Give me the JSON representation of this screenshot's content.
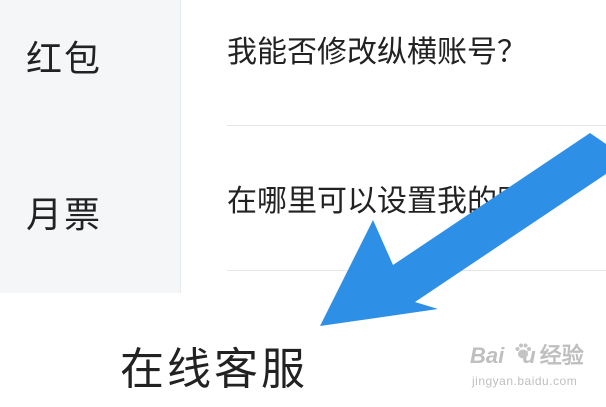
{
  "sidebar": {
    "items": [
      {
        "label": "红包"
      },
      {
        "label": "月票"
      }
    ]
  },
  "questions": {
    "items": [
      {
        "text": "我能否修改纵横账号？"
      },
      {
        "text": "在哪里可以设置我的账户"
      }
    ]
  },
  "bottom_bar": {
    "service_label": "在线客服"
  },
  "annotation": {
    "arrow_color": "#2e8fe6"
  },
  "watermark": {
    "brand_left": "Bai",
    "brand_right": "u",
    "brand_cn": "经验",
    "url": "jingyan.baidu.com"
  }
}
